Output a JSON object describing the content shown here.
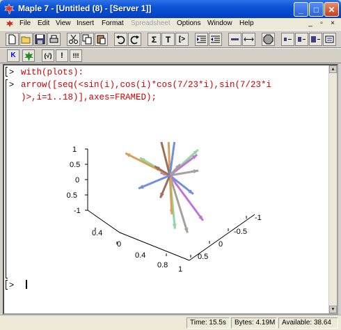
{
  "window": {
    "title": "Maple 7 - [Untitled (8) - [Server 1]]",
    "minimize": "_",
    "maximize": "□",
    "close": "✕"
  },
  "menubar": {
    "items": [
      "File",
      "Edit",
      "View",
      "Insert",
      "Format",
      "Spreadsheet",
      "Options",
      "Window",
      "Help"
    ],
    "disabled": [
      "Spreadsheet"
    ],
    "mdi_minimize": "_",
    "mdi_restore": "▫",
    "mdi_close": "×"
  },
  "toolbar": {
    "icons": [
      "new-icon",
      "open-icon",
      "save-icon",
      "print-icon",
      "cut-icon",
      "copy-icon",
      "paste-icon",
      "undo-icon",
      "redo-icon",
      "sigma-icon",
      "text-icon",
      "prompt-icon",
      "indent-icon",
      "outdent-icon",
      "stop-icon",
      "zoom-in-icon",
      "zoom-out-icon",
      "zoom-reset-icon",
      "history-icon"
    ],
    "sigma": "Σ",
    "text": "T",
    "prompt": "[>"
  },
  "toolbar2": {
    "k_label": "K",
    "sqrt_label": "(√)",
    "exclaim_label": "!",
    "double_exclaim_label": "!!!"
  },
  "worksheet": {
    "line1_prompt": ">",
    "line1_code": "with(plots):",
    "line2_prompt": ">",
    "line2_code_a": "arrow([seq(<sin(i),cos(i)*cos(7/23*i),sin(7/23*i",
    "line2_code_b": ")>,i=1..18)],axes=FRAMED);",
    "empty_prompt": ">"
  },
  "plot": {
    "z_ticks": [
      "1",
      "0.5",
      "0",
      "-0.5",
      "-1"
    ],
    "x_ticks": [
      "0.4",
      "0",
      "0.4",
      "0.8"
    ],
    "y_ticks": [
      "-1",
      "-0.5",
      "0",
      "0.5",
      "1"
    ],
    "colors": [
      "#6f8fe0",
      "#c074d8",
      "#a8a09a",
      "#8fd6a2",
      "#d9a15a",
      "#9b6f5a"
    ]
  },
  "status": {
    "time": "Time: 15.5s",
    "bytes": "Bytes: 4.19M",
    "available": "Available: 38.64"
  }
}
